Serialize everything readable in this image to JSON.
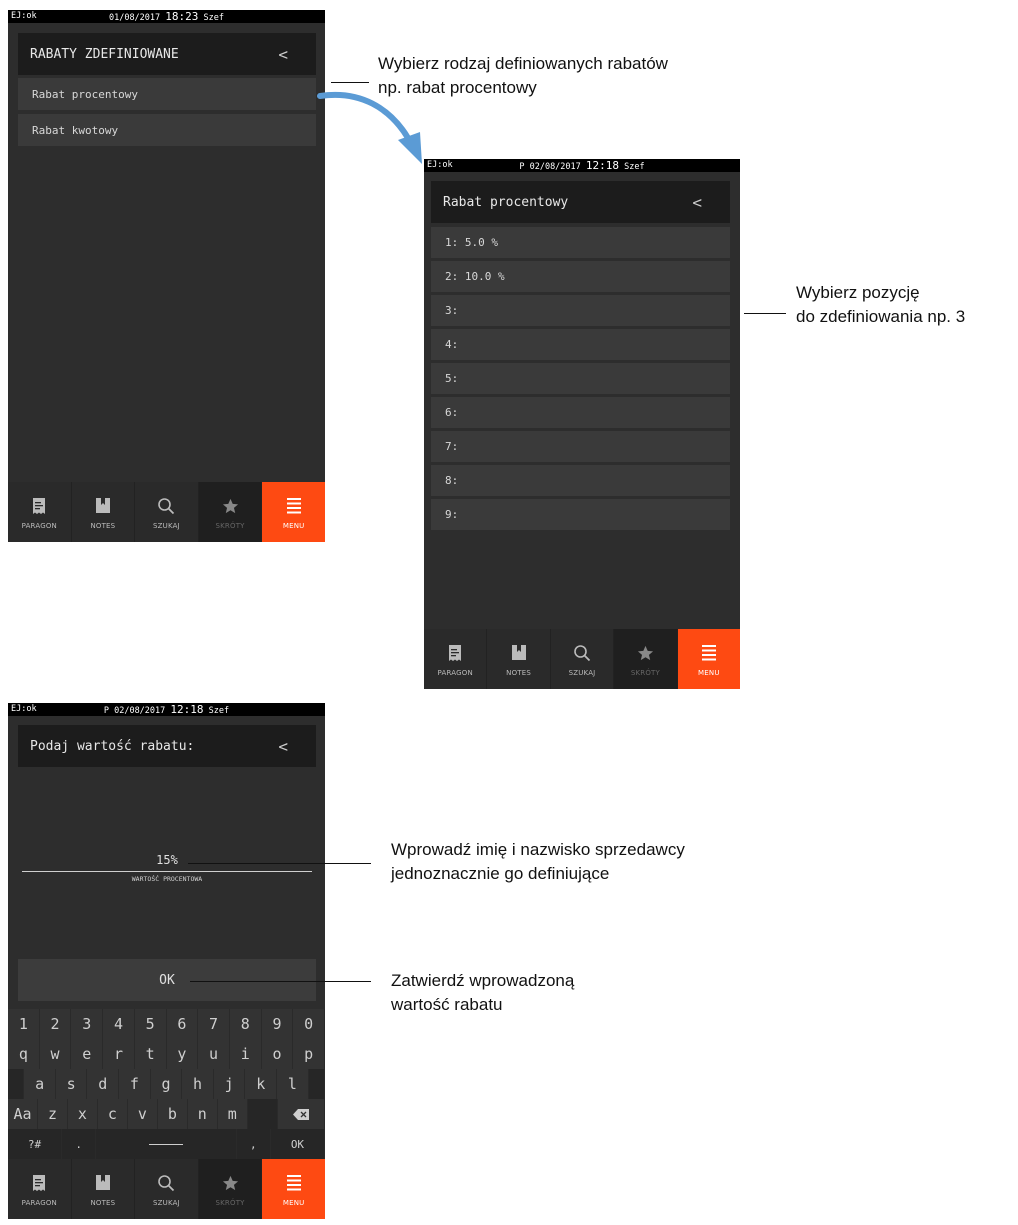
{
  "screen1": {
    "status": {
      "ej": "EJ:ok",
      "date": "01/08/2017",
      "time": "18:23",
      "user": "Szef"
    },
    "header": {
      "title": "RABATY ZDEFINIOWANE",
      "back": "<"
    },
    "items": [
      {
        "label": "Rabat procentowy"
      },
      {
        "label": "Rabat kwotowy"
      }
    ]
  },
  "screen2": {
    "status": {
      "ej": "EJ:ok",
      "prefix": "P",
      "date": "02/08/2017",
      "time": "12:18",
      "user": "Szef"
    },
    "header": {
      "title": "Rabat procentowy",
      "back": "<"
    },
    "items": [
      {
        "label": "1: 5.0 %"
      },
      {
        "label": "2: 10.0 %"
      },
      {
        "label": "3:"
      },
      {
        "label": "4:"
      },
      {
        "label": "5:"
      },
      {
        "label": "6:"
      },
      {
        "label": "7:"
      },
      {
        "label": "8:"
      },
      {
        "label": "9:"
      }
    ]
  },
  "screen3": {
    "status": {
      "ej": "EJ:ok",
      "prefix": "P",
      "date": "02/08/2017",
      "time": "12:18",
      "user": "Szef"
    },
    "header": {
      "title": "Podaj wartość rabatu:",
      "back": "<"
    },
    "input": {
      "value": "15%",
      "caption": "WARTOŚĆ PROCENTOWA"
    },
    "ok_button": "OK",
    "keyboard": {
      "row1": [
        "1",
        "2",
        "3",
        "4",
        "5",
        "6",
        "7",
        "8",
        "9",
        "0"
      ],
      "row2": [
        "q",
        "w",
        "e",
        "r",
        "t",
        "y",
        "u",
        "i",
        "o",
        "p"
      ],
      "row3": [
        "a",
        "s",
        "d",
        "f",
        "g",
        "h",
        "j",
        "k",
        "l"
      ],
      "row4": [
        "Aa",
        "z",
        "x",
        "c",
        "v",
        "b",
        "n",
        "m"
      ],
      "row5": {
        "sym": "?#",
        "dot": ".",
        "comma": ",",
        "ok": "OK"
      }
    }
  },
  "nav": {
    "paragon": "PARAGON",
    "notes": "NOTES",
    "szukaj": "SZUKAJ",
    "skroty": "SKRÓTY",
    "menu": "MENU"
  },
  "annotations": {
    "a1_line1": "Wybierz rodzaj definiowanych rabatów",
    "a1_line2": "np. rabat procentowy",
    "a2_line1": "Wybierz pozycję",
    "a2_line2": "do zdefiniowania np. 3",
    "a3_line1": "Wprowadź imię i nazwisko sprzedawcy",
    "a3_line2": "jednoznacznie go definiujące",
    "a4_line1": "Zatwierdź wprowadzoną",
    "a4_line2": "wartość rabatu"
  },
  "colors": {
    "menu_accent": "#fe4a12",
    "arrow": "#5b9bd5",
    "screen_bg": "#2d2d2d"
  }
}
